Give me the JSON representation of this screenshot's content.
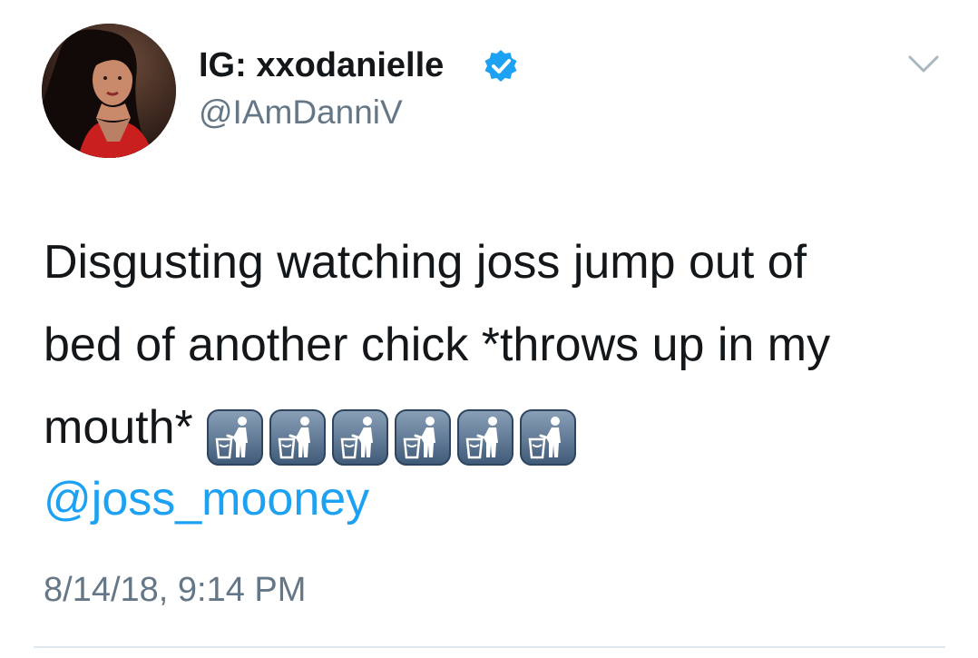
{
  "author": {
    "display_name": "IG: xxodanielle",
    "handle": "@IAmDanniV",
    "verified": true,
    "avatar_icon": "profile-photo"
  },
  "tweet": {
    "lines": [
      "Disgusting watching joss jump out of",
      "bed of another chick *throws up in my",
      "mouth*"
    ],
    "emoji_name": "put-litter-in-its-place-icon",
    "emoji_count": 6,
    "mention": "@joss_mooney",
    "timestamp": "8/14/18, 9:14 PM"
  },
  "colors": {
    "link": "#1da1f2",
    "secondary_text": "#657786",
    "verified": "#1da1f2",
    "divider": "#e1e8ed"
  }
}
